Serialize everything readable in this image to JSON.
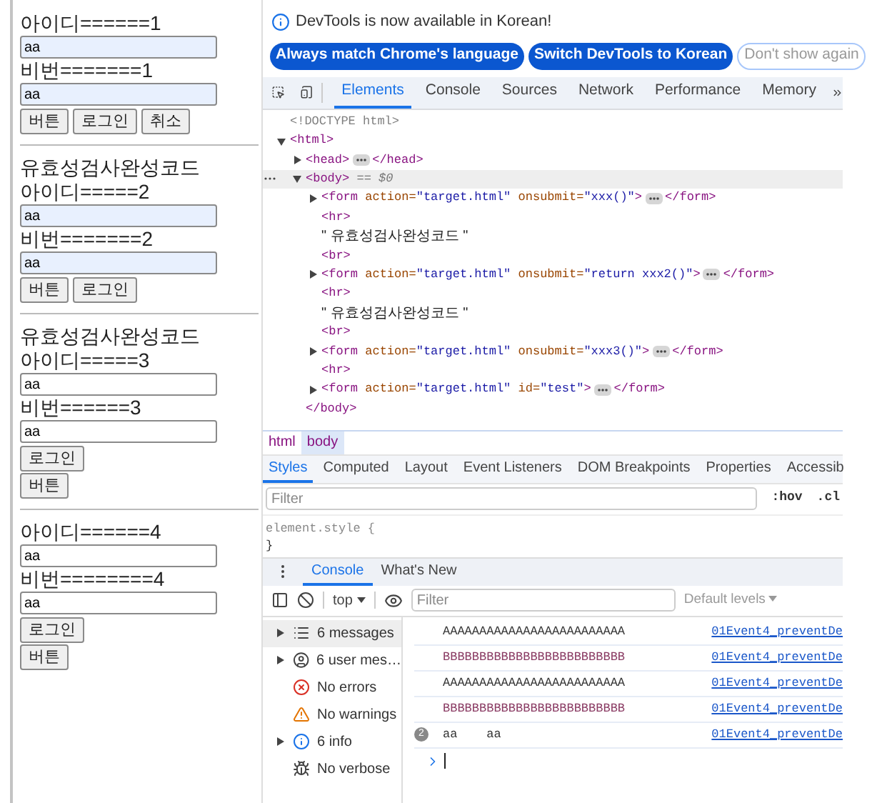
{
  "page": {
    "forms": [
      {
        "fields": [
          {
            "label": "아이디======1",
            "value": "aa",
            "autofilled": true
          },
          {
            "label": "비번=======1",
            "value": "aa",
            "autofilled": true
          }
        ],
        "button_rows": [
          [
            "버튼",
            "로그인",
            "취소"
          ]
        ]
      },
      {
        "heading": "유효성검사완성코드",
        "fields": [
          {
            "label": "아이디=====2",
            "value": "aa",
            "autofilled": true
          },
          {
            "label": "비번=======2",
            "value": "aa",
            "autofilled": true
          }
        ],
        "button_rows": [
          [
            "버튼",
            "로그인"
          ]
        ]
      },
      {
        "heading": "유효성검사완성코드",
        "fields": [
          {
            "label": "아이디=====3",
            "value": "aa",
            "autofilled": false
          },
          {
            "label": "비번======3",
            "value": "aa",
            "autofilled": false
          }
        ],
        "button_rows": [
          [
            "로그인"
          ],
          [
            "버튼"
          ]
        ]
      },
      {
        "fields": [
          {
            "label": "아이디======4",
            "value": "aa",
            "autofilled": false
          },
          {
            "label": "비번========4",
            "value": "aa",
            "autofilled": false
          }
        ],
        "button_rows": [
          [
            "로그인"
          ],
          [
            "버튼"
          ]
        ]
      }
    ]
  },
  "devtools": {
    "notice": {
      "text": "DevTools is now available in Korean!",
      "buttons": [
        {
          "label": "Always match Chrome's language",
          "kind": "primary"
        },
        {
          "label": "Switch DevTools to Korean",
          "kind": "primary"
        },
        {
          "label": "Don't show again",
          "kind": "outline"
        }
      ]
    },
    "tabs": [
      {
        "label": "Elements",
        "selected": true
      },
      {
        "label": "Console",
        "selected": false
      },
      {
        "label": "Sources",
        "selected": false
      },
      {
        "label": "Network",
        "selected": false
      },
      {
        "label": "Performance",
        "selected": false
      },
      {
        "label": "Memory",
        "selected": false
      }
    ],
    "tree": [
      {
        "kind": "doctype",
        "text": "<!DOCTYPE html>"
      },
      {
        "kind": "element",
        "open": "<html>",
        "expanded": true,
        "children": [
          {
            "kind": "element",
            "open": "<head>",
            "end": "</head>",
            "expanded": false
          },
          {
            "kind": "element",
            "open": "<body>",
            "note": "== $0",
            "selected": true,
            "expanded": true,
            "close": "</body>",
            "children": [
              {
                "kind": "element",
                "open": "<form",
                "attrs": [
                  {
                    "name": "action=",
                    "value": "\"target.html\""
                  },
                  {
                    "name": "onsubmit=",
                    "value": "\"xxx()\""
                  }
                ],
                "open_end": ">",
                "end": "</form>",
                "expanded": false
              },
              {
                "kind": "leaf",
                "text": "<hr>"
              },
              {
                "kind": "text",
                "text": "\" 유효성검사완성코드 \""
              },
              {
                "kind": "leaf",
                "text": "<br>"
              },
              {
                "kind": "element",
                "open": "<form",
                "attrs": [
                  {
                    "name": "action=",
                    "value": "\"target.html\""
                  },
                  {
                    "name": "onsubmit=",
                    "value": "\"return xxx2()\""
                  }
                ],
                "open_end": ">",
                "end": "</form>",
                "expanded": false
              },
              {
                "kind": "leaf",
                "text": "<hr>"
              },
              {
                "kind": "text",
                "text": "\" 유효성검사완성코드 \""
              },
              {
                "kind": "leaf",
                "text": "<br>"
              },
              {
                "kind": "element",
                "open": "<form",
                "attrs": [
                  {
                    "name": "action=",
                    "value": "\"target.html\""
                  },
                  {
                    "name": "onsubmit=",
                    "value": "\"xxx3()\""
                  }
                ],
                "open_end": ">",
                "end": "</form>",
                "expanded": false
              },
              {
                "kind": "leaf",
                "text": "<hr>"
              },
              {
                "kind": "element",
                "open": "<form",
                "attrs": [
                  {
                    "name": "action=",
                    "value": "\"target.html\""
                  },
                  {
                    "name": "id=",
                    "value": "\"test\""
                  }
                ],
                "open_end": ">",
                "end": "</form>",
                "expanded": false
              }
            ]
          }
        ]
      }
    ],
    "breadcrumb": [
      {
        "label": "html",
        "selected": false
      },
      {
        "label": "body",
        "selected": true
      }
    ],
    "styles_tabs": [
      {
        "label": "Styles",
        "selected": true
      },
      {
        "label": "Computed",
        "selected": false
      },
      {
        "label": "Layout",
        "selected": false
      },
      {
        "label": "Event Listeners",
        "selected": false
      },
      {
        "label": "DOM Breakpoints",
        "selected": false
      },
      {
        "label": "Properties",
        "selected": false
      },
      {
        "label": "Accessib",
        "selected": false
      }
    ],
    "styles_filter": {
      "placeholder": "Filter",
      "hov": ":hov",
      "cls": ".cl"
    },
    "element_style": {
      "open": "element.style {",
      "close": "}"
    },
    "drawer_tabs": [
      {
        "label": "Console",
        "selected": true
      },
      {
        "label": "What's New",
        "selected": false
      }
    ],
    "console_toolbar": {
      "context": "top",
      "filter_placeholder": "Filter",
      "levels": "Default levels"
    },
    "console_sidebar": [
      {
        "label": "6 messages",
        "kind": "messages",
        "expandable": true,
        "selected": true
      },
      {
        "label": "6 user mes…",
        "kind": "user",
        "expandable": true,
        "selected": false
      },
      {
        "label": "No errors",
        "kind": "errors",
        "expandable": false,
        "selected": false
      },
      {
        "label": "No warnings",
        "kind": "warnings",
        "expandable": false,
        "selected": false
      },
      {
        "label": "6 info",
        "kind": "info",
        "expandable": true,
        "selected": false
      },
      {
        "label": "No verbose",
        "kind": "verbose",
        "expandable": false,
        "selected": false
      }
    ],
    "console_log": [
      {
        "text": "AAAAAAAAAAAAAAAAAAAAAAAAA",
        "color": "#333333",
        "source": "01Event4_preventDe"
      },
      {
        "text": "BBBBBBBBBBBBBBBBBBBBBBBBB",
        "color": "#8a3b63",
        "source": "01Event4_preventDe"
      },
      {
        "text": "AAAAAAAAAAAAAAAAAAAAAAAAA",
        "color": "#333333",
        "source": "01Event4_preventDe"
      },
      {
        "text": "BBBBBBBBBBBBBBBBBBBBBBBBB",
        "color": "#8a3b63",
        "source": "01Event4_preventDe"
      },
      {
        "count": "2",
        "text": "aa    aa",
        "color": "#333333",
        "source": "01Event4_preventDe"
      }
    ]
  }
}
